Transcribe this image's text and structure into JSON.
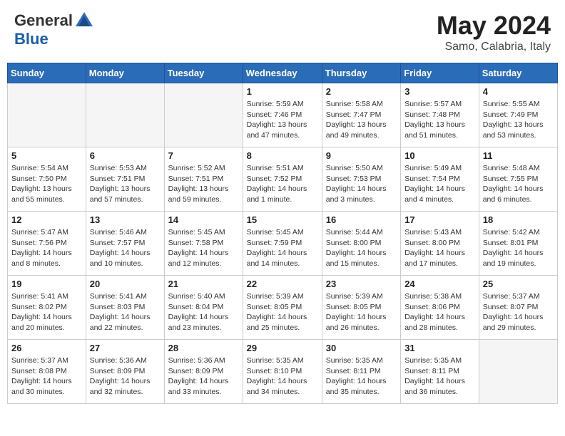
{
  "header": {
    "logo_line1": "General",
    "logo_line2": "Blue",
    "month_title": "May 2024",
    "location": "Samo, Calabria, Italy"
  },
  "weekdays": [
    "Sunday",
    "Monday",
    "Tuesday",
    "Wednesday",
    "Thursday",
    "Friday",
    "Saturday"
  ],
  "weeks": [
    [
      {
        "day": "",
        "info": ""
      },
      {
        "day": "",
        "info": ""
      },
      {
        "day": "",
        "info": ""
      },
      {
        "day": "1",
        "info": "Sunrise: 5:59 AM\nSunset: 7:46 PM\nDaylight: 13 hours\nand 47 minutes."
      },
      {
        "day": "2",
        "info": "Sunrise: 5:58 AM\nSunset: 7:47 PM\nDaylight: 13 hours\nand 49 minutes."
      },
      {
        "day": "3",
        "info": "Sunrise: 5:57 AM\nSunset: 7:48 PM\nDaylight: 13 hours\nand 51 minutes."
      },
      {
        "day": "4",
        "info": "Sunrise: 5:55 AM\nSunset: 7:49 PM\nDaylight: 13 hours\nand 53 minutes."
      }
    ],
    [
      {
        "day": "5",
        "info": "Sunrise: 5:54 AM\nSunset: 7:50 PM\nDaylight: 13 hours\nand 55 minutes."
      },
      {
        "day": "6",
        "info": "Sunrise: 5:53 AM\nSunset: 7:51 PM\nDaylight: 13 hours\nand 57 minutes."
      },
      {
        "day": "7",
        "info": "Sunrise: 5:52 AM\nSunset: 7:51 PM\nDaylight: 13 hours\nand 59 minutes."
      },
      {
        "day": "8",
        "info": "Sunrise: 5:51 AM\nSunset: 7:52 PM\nDaylight: 14 hours\nand 1 minute."
      },
      {
        "day": "9",
        "info": "Sunrise: 5:50 AM\nSunset: 7:53 PM\nDaylight: 14 hours\nand 3 minutes."
      },
      {
        "day": "10",
        "info": "Sunrise: 5:49 AM\nSunset: 7:54 PM\nDaylight: 14 hours\nand 4 minutes."
      },
      {
        "day": "11",
        "info": "Sunrise: 5:48 AM\nSunset: 7:55 PM\nDaylight: 14 hours\nand 6 minutes."
      }
    ],
    [
      {
        "day": "12",
        "info": "Sunrise: 5:47 AM\nSunset: 7:56 PM\nDaylight: 14 hours\nand 8 minutes."
      },
      {
        "day": "13",
        "info": "Sunrise: 5:46 AM\nSunset: 7:57 PM\nDaylight: 14 hours\nand 10 minutes."
      },
      {
        "day": "14",
        "info": "Sunrise: 5:45 AM\nSunset: 7:58 PM\nDaylight: 14 hours\nand 12 minutes."
      },
      {
        "day": "15",
        "info": "Sunrise: 5:45 AM\nSunset: 7:59 PM\nDaylight: 14 hours\nand 14 minutes."
      },
      {
        "day": "16",
        "info": "Sunrise: 5:44 AM\nSunset: 8:00 PM\nDaylight: 14 hours\nand 15 minutes."
      },
      {
        "day": "17",
        "info": "Sunrise: 5:43 AM\nSunset: 8:00 PM\nDaylight: 14 hours\nand 17 minutes."
      },
      {
        "day": "18",
        "info": "Sunrise: 5:42 AM\nSunset: 8:01 PM\nDaylight: 14 hours\nand 19 minutes."
      }
    ],
    [
      {
        "day": "19",
        "info": "Sunrise: 5:41 AM\nSunset: 8:02 PM\nDaylight: 14 hours\nand 20 minutes."
      },
      {
        "day": "20",
        "info": "Sunrise: 5:41 AM\nSunset: 8:03 PM\nDaylight: 14 hours\nand 22 minutes."
      },
      {
        "day": "21",
        "info": "Sunrise: 5:40 AM\nSunset: 8:04 PM\nDaylight: 14 hours\nand 23 minutes."
      },
      {
        "day": "22",
        "info": "Sunrise: 5:39 AM\nSunset: 8:05 PM\nDaylight: 14 hours\nand 25 minutes."
      },
      {
        "day": "23",
        "info": "Sunrise: 5:39 AM\nSunset: 8:05 PM\nDaylight: 14 hours\nand 26 minutes."
      },
      {
        "day": "24",
        "info": "Sunrise: 5:38 AM\nSunset: 8:06 PM\nDaylight: 14 hours\nand 28 minutes."
      },
      {
        "day": "25",
        "info": "Sunrise: 5:37 AM\nSunset: 8:07 PM\nDaylight: 14 hours\nand 29 minutes."
      }
    ],
    [
      {
        "day": "26",
        "info": "Sunrise: 5:37 AM\nSunset: 8:08 PM\nDaylight: 14 hours\nand 30 minutes."
      },
      {
        "day": "27",
        "info": "Sunrise: 5:36 AM\nSunset: 8:09 PM\nDaylight: 14 hours\nand 32 minutes."
      },
      {
        "day": "28",
        "info": "Sunrise: 5:36 AM\nSunset: 8:09 PM\nDaylight: 14 hours\nand 33 minutes."
      },
      {
        "day": "29",
        "info": "Sunrise: 5:35 AM\nSunset: 8:10 PM\nDaylight: 14 hours\nand 34 minutes."
      },
      {
        "day": "30",
        "info": "Sunrise: 5:35 AM\nSunset: 8:11 PM\nDaylight: 14 hours\nand 35 minutes."
      },
      {
        "day": "31",
        "info": "Sunrise: 5:35 AM\nSunset: 8:11 PM\nDaylight: 14 hours\nand 36 minutes."
      },
      {
        "day": "",
        "info": ""
      }
    ]
  ]
}
